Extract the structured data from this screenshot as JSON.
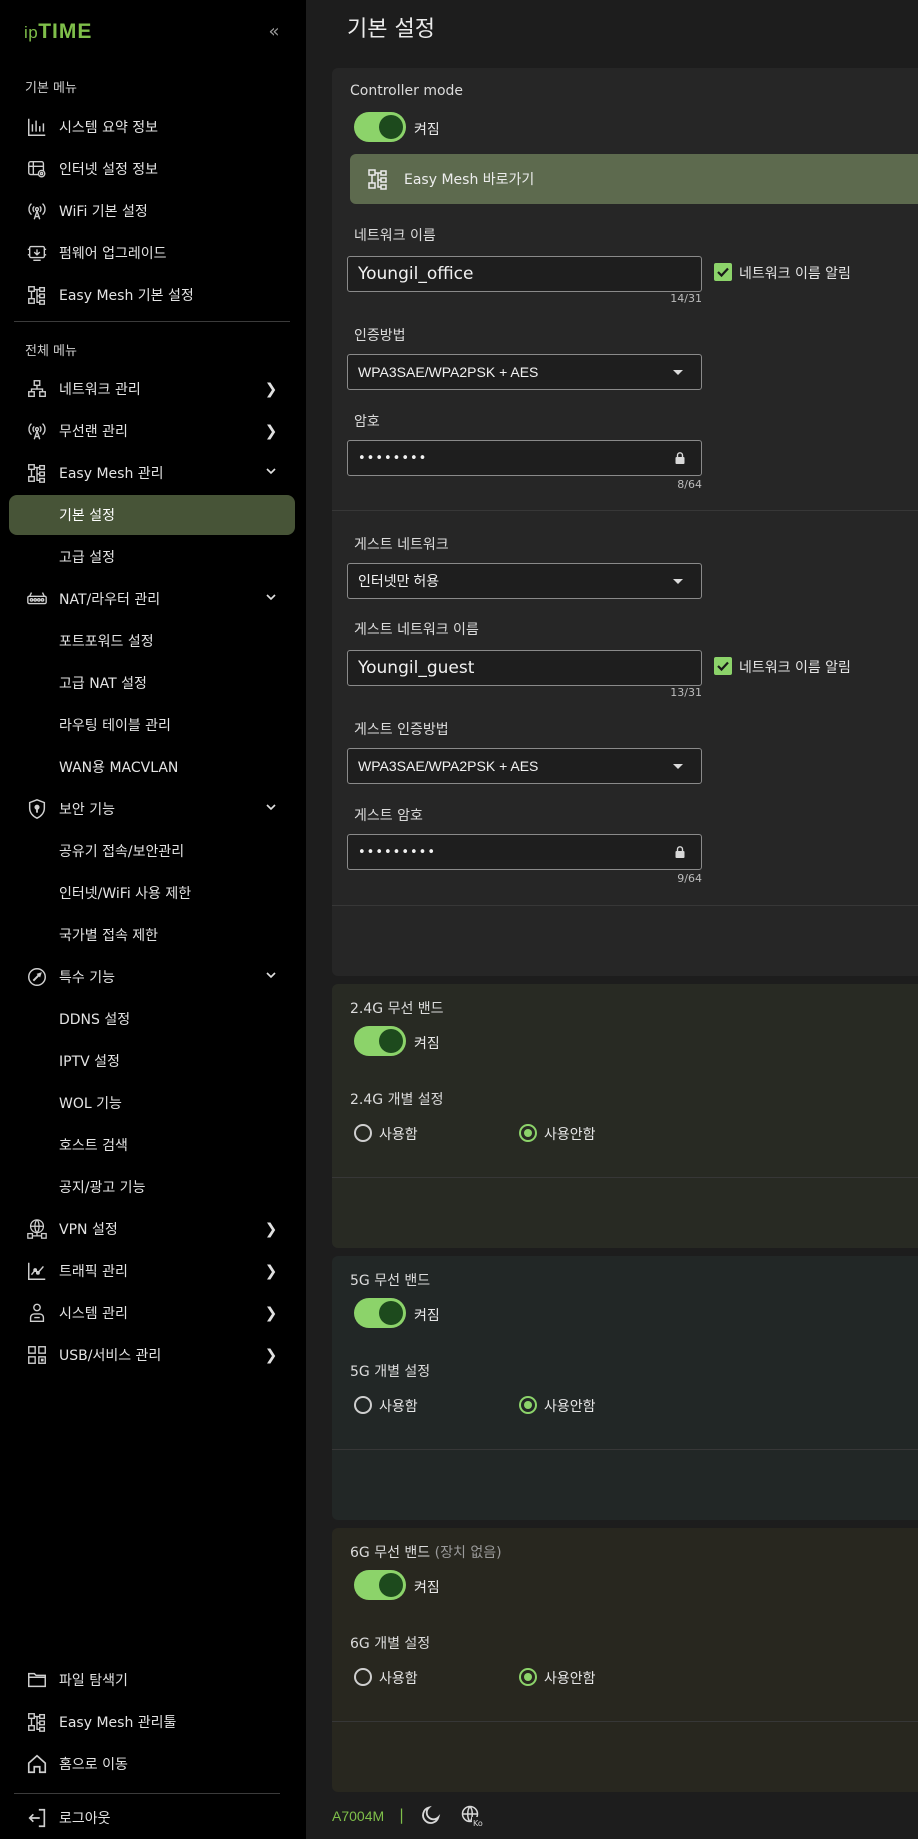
{
  "sidebar": {
    "logo_ip": "ip",
    "logo_time": "TIME",
    "collapse_icon": "«",
    "basic_menu_title": "기본 메뉴",
    "basic_menu": [
      {
        "label": "시스템 요약 정보",
        "icon": "bar-chart-icon"
      },
      {
        "label": "인터넷 설정 정보",
        "icon": "globe-settings-icon"
      },
      {
        "label": "WiFi 기본 설정",
        "icon": "wifi-antenna-icon"
      },
      {
        "label": "펌웨어 업그레이드",
        "icon": "firmware-icon"
      },
      {
        "label": "Easy Mesh 기본 설정",
        "icon": "mesh-icon"
      }
    ],
    "full_menu_title": "전체 메뉴",
    "full_menu": [
      {
        "label": "네트워크 관리",
        "chevron": "›"
      },
      {
        "label": "무선랜 관리",
        "chevron": "›"
      },
      {
        "label": "Easy Mesh 관리",
        "chevron": "⌄"
      },
      {
        "label": "기본 설정"
      },
      {
        "label": "고급 설정"
      },
      {
        "label": "NAT/라우터 관리",
        "chevron": "⌄"
      },
      {
        "label": "포트포워드 설정"
      },
      {
        "label": "고급 NAT 설정"
      },
      {
        "label": "라우팅 테이블 관리"
      },
      {
        "label": "WAN용 MACVLAN"
      },
      {
        "label": "보안 기능",
        "chevron": "⌄"
      },
      {
        "label": "공유기 접속/보안관리"
      },
      {
        "label": "인터넷/WiFi 사용 제한"
      },
      {
        "label": "국가별 접속 제한"
      },
      {
        "label": "특수 기능",
        "chevron": "⌄"
      },
      {
        "label": "DDNS 설정"
      },
      {
        "label": "IPTV 설정"
      },
      {
        "label": "WOL 기능"
      },
      {
        "label": "호스트 검색"
      },
      {
        "label": "공지/광고 기능"
      },
      {
        "label": "VPN 설정",
        "chevron": "›"
      },
      {
        "label": "트래픽 관리",
        "chevron": "›"
      },
      {
        "label": "시스템 관리",
        "chevron": "›"
      },
      {
        "label": "USB/서비스 관리",
        "chevron": "›"
      }
    ],
    "bottom_menu": [
      {
        "label": "파일 탐색기"
      },
      {
        "label": "Easy Mesh 관리툴"
      },
      {
        "label": "홈으로 이동"
      },
      {
        "label": "로그아웃"
      }
    ]
  },
  "main": {
    "title": "기본 설정",
    "controller": {
      "label": "Controller mode",
      "toggle_text": "켜짐",
      "mesh_button": "Easy Mesh 바로가기"
    },
    "network": {
      "name_label": "네트워크 이름",
      "name_value": "Youngil_office",
      "name_counter": "14/31",
      "broadcast_label": "네트워크 이름 알림",
      "auth_label": "인증방법",
      "auth_value": "WPA3SAE/WPA2PSK + AES",
      "pw_label": "암호",
      "pw_value": "••••••••",
      "pw_counter": "8/64"
    },
    "guest": {
      "label": "게스트 네트워크",
      "mode_value": "인터넷만 허용",
      "name_label": "게스트 네트워크 이름",
      "name_value": "Youngil_guest",
      "name_counter": "13/31",
      "broadcast_label": "네트워크 이름 알림",
      "auth_label": "게스트 인증방법",
      "auth_value": "WPA3SAE/WPA2PSK + AES",
      "pw_label": "게스트 암호",
      "pw_value": "•••••••••",
      "pw_counter": "9/64"
    },
    "band24": {
      "label": "2.4G 무선 밴드",
      "toggle_text": "켜짐",
      "individual_label": "2.4G 개별 설정",
      "opt_use": "사용함",
      "opt_nouse": "사용안함"
    },
    "band5": {
      "label": "5G 무선 밴드",
      "toggle_text": "켜짐",
      "individual_label": "5G 개별 설정",
      "opt_use": "사용함",
      "opt_nouse": "사용안함"
    },
    "band6": {
      "label": "6G 무선 밴드",
      "sub": "(장치 없음)",
      "toggle_text": "켜짐",
      "individual_label": "6G 개별 설정",
      "opt_use": "사용함",
      "opt_nouse": "사용안함"
    }
  },
  "footer": {
    "model": "A7004M",
    "separator": "|"
  },
  "colors": {
    "accent": "#8cd36a",
    "active_bg": "#475437",
    "logo": "#7fbf4a"
  }
}
